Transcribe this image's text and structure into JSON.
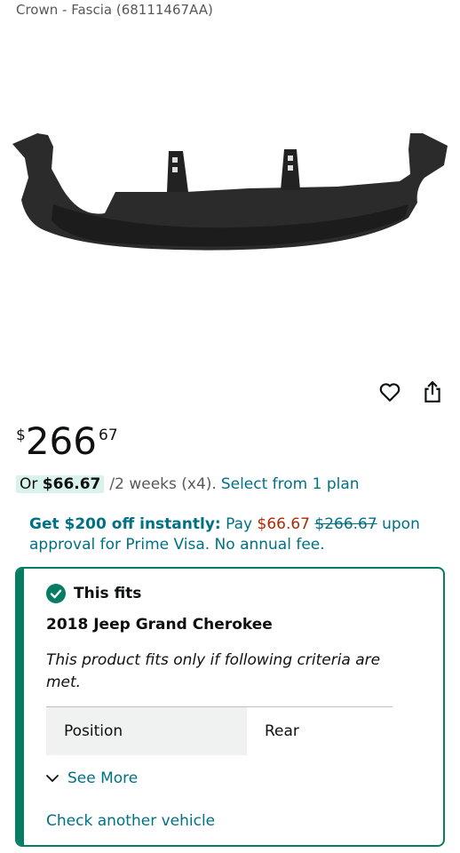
{
  "product": {
    "title": "Crown - Fascia (68111467AA)"
  },
  "icons": {
    "wishlist": "heart-icon",
    "share": "share-icon"
  },
  "price": {
    "currency": "$",
    "whole": "266",
    "fraction": "67"
  },
  "plan": {
    "prefix": "Or",
    "amount": "$66.67",
    "term": "/2 weeks (x4).",
    "link": "Select from 1 plan"
  },
  "promo": {
    "bold": "Get $200 off instantly:",
    "pay": "Pay",
    "sale_price": "$66.67",
    "old_price": "$266.67",
    "rest": "upon approval for Prime Visa. No annual fee."
  },
  "fit": {
    "title": "This fits",
    "vehicle": "2018 Jeep Grand Cherokee",
    "criteria": "This product fits only if following criteria are met.",
    "rows": [
      {
        "label": "Position",
        "value": "Rear"
      }
    ],
    "see_more": "See More",
    "check_another": "Check another vehicle"
  },
  "colors": {
    "accent_green": "#067d62",
    "link_teal": "#007185",
    "price_red": "#b12704",
    "badge_bg": "#d9f2ec"
  }
}
